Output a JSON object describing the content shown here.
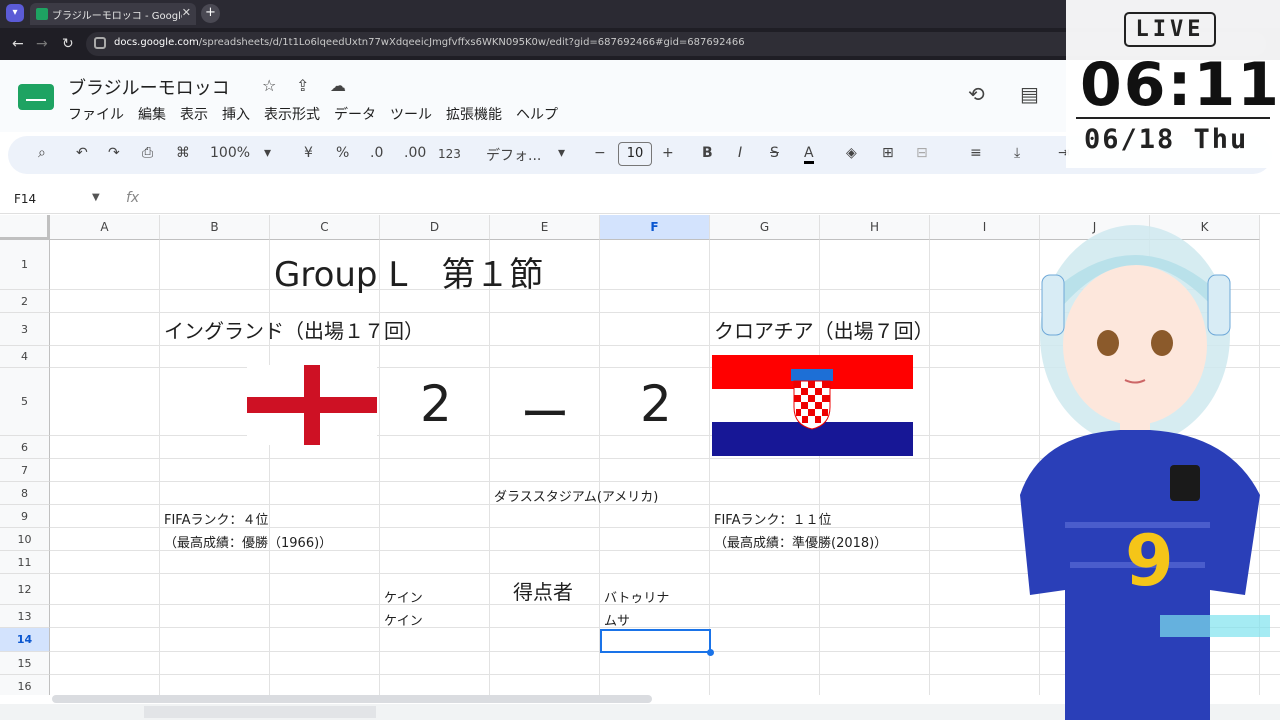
{
  "browser": {
    "tab_title": "ブラジルーモロッコ - Google スプレッ",
    "tab_close": "✕",
    "new_tab": "+",
    "url_host": "docs.google.com",
    "url_path": "/spreadsheets/d/1t1Lo6lqeedUxtn77wXdqeeicJmgfvffxs6WKN095K0w/edit?gid=687692466#gid=687692466"
  },
  "app": {
    "doc_title": "ブラジルーモロッコ",
    "menu": [
      "ファイル",
      "編集",
      "表示",
      "挿入",
      "表示形式",
      "データ",
      "ツール",
      "拡張機能",
      "ヘルプ"
    ]
  },
  "toolbar": {
    "zoom": "100%",
    "currency": "¥",
    "percent": "%",
    "dec_decrease": ".0",
    "dec_increase": ".00",
    "number_format": "123",
    "font": "デフォ...",
    "font_size": "10",
    "bold": "B",
    "italic": "I",
    "strike": "S",
    "text_color": "A"
  },
  "formula_bar": {
    "name_box": "F14",
    "fx": "fx"
  },
  "columns": [
    "A",
    "B",
    "C",
    "D",
    "E",
    "F",
    "G",
    "H",
    "I",
    "J",
    "K"
  ],
  "rows": [
    "1",
    "2",
    "3",
    "4",
    "5",
    "6",
    "7",
    "8",
    "9",
    "10",
    "11",
    "12",
    "13",
    "14",
    "15",
    "16"
  ],
  "sheet": {
    "title": "Group L　第１節",
    "team_left": "イングランド（出場１７回）",
    "team_right": "クロアチア（出場７回）",
    "score_left": "2",
    "score_dash": "ー",
    "score_right": "2",
    "venue": "ダラススタジアム(アメリカ)",
    "rank_left": "FIFAランク：４位",
    "best_left": "（最高成績：優勝（1966)）",
    "rank_right": "FIFAランク：１１位",
    "best_right": "（最高成績：準優勝(2018)）",
    "scorers_label": "得点者",
    "scorers_left": [
      "ケイン",
      "ケイン"
    ],
    "scorers_right": [
      "バトゥリナ",
      "ムサ"
    ]
  },
  "overlay": {
    "live": "LIVE",
    "time": "06:11",
    "date": "06/18 Thu"
  },
  "colors": {
    "sheets_green": "#1ea362",
    "selection_blue": "#1a73e8",
    "england_red": "#ce1124",
    "croatia_red": "#ff0000",
    "croatia_blue": "#171796"
  }
}
